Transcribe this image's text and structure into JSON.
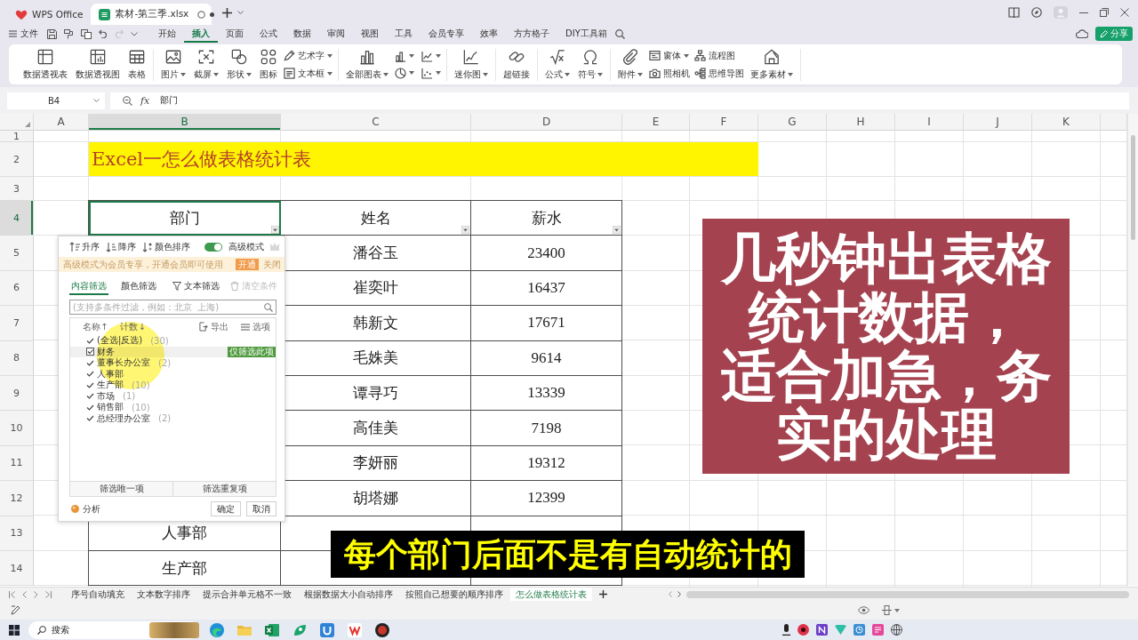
{
  "titlebar": {
    "tabs": [
      {
        "kind": "home",
        "label": "WPS Office",
        "selected": false,
        "unsaved": false
      },
      {
        "kind": "document",
        "label": "素材-第三季.xlsx",
        "selected": true,
        "unsaved": true
      }
    ]
  },
  "menubar": {
    "file": "文件",
    "undo": {
      "disabled": false
    },
    "redo": {
      "disabled": true
    },
    "tabs": [
      {
        "label": "开始",
        "selected": false
      },
      {
        "label": "插入",
        "selected": true
      },
      {
        "label": "页面",
        "selected": false
      },
      {
        "label": "公式",
        "selected": false
      },
      {
        "label": "数据",
        "selected": false
      },
      {
        "label": "审阅",
        "selected": false
      },
      {
        "label": "视图",
        "selected": false
      },
      {
        "label": "工具",
        "selected": false
      },
      {
        "label": "会员专享",
        "selected": false
      },
      {
        "label": "效率",
        "selected": false
      },
      {
        "label": "方方格子",
        "selected": false
      },
      {
        "label": "DIY工具箱",
        "selected": false
      }
    ],
    "share": "分享"
  },
  "ribbon": {
    "groups": [
      [
        {
          "kind": "large",
          "label": "数据透视表",
          "dropdown": false
        },
        {
          "kind": "large",
          "label": "数据透视图",
          "dropdown": false
        },
        {
          "kind": "large",
          "label": "表格",
          "dropdown": false
        }
      ],
      [
        {
          "kind": "large",
          "label": "图片",
          "dropdown": true
        },
        {
          "kind": "large",
          "label": "截屏",
          "dropdown": true
        },
        {
          "kind": "large",
          "label": "形状",
          "dropdown": true
        },
        {
          "kind": "large",
          "label": "图标",
          "dropdown": false
        },
        {
          "kind": "stack",
          "items": [
            {
              "label": "艺术字",
              "dropdown": true
            },
            {
              "label": "文本框",
              "dropdown": true
            }
          ]
        }
      ],
      [
        {
          "kind": "large",
          "label": "全部图表",
          "dropdown": true
        },
        {
          "kind": "grid",
          "items": [
            {
              "dropdown": true
            },
            {
              "dropdown": true
            },
            {
              "dropdown": true
            },
            {
              "dropdown": true
            }
          ]
        }
      ],
      [
        {
          "kind": "large",
          "label": "迷你图",
          "dropdown": true
        }
      ],
      [
        {
          "kind": "large",
          "label": "超链接",
          "dropdown": false
        }
      ],
      [
        {
          "kind": "large",
          "label": "公式",
          "dropdown": true
        },
        {
          "kind": "large",
          "label": "符号",
          "dropdown": true
        }
      ],
      [
        {
          "kind": "large",
          "label": "附件",
          "dropdown": true
        },
        {
          "kind": "stack",
          "items": [
            {
              "label": "窗体",
              "dropdown": true
            },
            {
              "label": "照相机",
              "dropdown": false
            }
          ]
        },
        {
          "kind": "stack",
          "items": [
            {
              "label": "流程图",
              "dropdown": false
            },
            {
              "label": "思维导图",
              "dropdown": false
            }
          ]
        },
        {
          "kind": "large",
          "label": "更多素材",
          "dropdown": true
        }
      ]
    ]
  },
  "formula_bar": {
    "name_box": "B4",
    "function_button": "fx",
    "formula": "部门"
  },
  "sheet": {
    "columns": [
      {
        "label": "A",
        "selected": false
      },
      {
        "label": "B",
        "selected": true
      },
      {
        "label": "C",
        "selected": false
      },
      {
        "label": "D",
        "selected": false
      },
      {
        "label": "E",
        "selected": false
      },
      {
        "label": "F",
        "selected": false
      },
      {
        "label": "G",
        "selected": false
      },
      {
        "label": "H",
        "selected": false
      },
      {
        "label": "I",
        "selected": false
      },
      {
        "label": "J",
        "selected": false
      },
      {
        "label": "K",
        "selected": false
      }
    ],
    "rows": [
      {
        "label": "1",
        "selected": false
      },
      {
        "label": "2",
        "selected": false
      },
      {
        "label": "3",
        "selected": false
      },
      {
        "label": "4",
        "selected": true
      },
      {
        "label": "5",
        "selected": false
      },
      {
        "label": "6",
        "selected": false
      },
      {
        "label": "7",
        "selected": false
      },
      {
        "label": "8",
        "selected": false
      },
      {
        "label": "9",
        "selected": false
      },
      {
        "label": "10",
        "selected": false
      },
      {
        "label": "11",
        "selected": false
      },
      {
        "label": "12",
        "selected": false
      },
      {
        "label": "13",
        "selected": false
      },
      {
        "label": "14",
        "selected": false
      }
    ],
    "title": "Excel一怎么做表格统计表",
    "table": {
      "headers": [
        {
          "label": "部门",
          "selected": true,
          "filter": true
        },
        {
          "label": "姓名",
          "selected": false,
          "filter": true
        },
        {
          "label": "薪水",
          "selected": false,
          "filter": true
        }
      ],
      "rows": [
        {
          "name": "潘谷玉",
          "salary": "23400"
        },
        {
          "name": "崔奕叶",
          "salary": "16437"
        },
        {
          "name": "韩新文",
          "salary": "17671"
        },
        {
          "name": "毛姝美",
          "salary": "9614"
        },
        {
          "name": "谭寻巧",
          "salary": "13339"
        },
        {
          "name": "高佳美",
          "salary": "7198"
        },
        {
          "name": "李妍丽",
          "salary": "19312"
        },
        {
          "name": "胡塔娜",
          "salary": "12399"
        },
        {
          "department": "人事部"
        },
        {
          "department": "生产部"
        }
      ]
    }
  },
  "filter_panel": {
    "sort_buttons": [
      {
        "label": "升序"
      },
      {
        "label": "降序"
      },
      {
        "label": "颜色排序"
      }
    ],
    "mode_toggle": {
      "label": "高级模式",
      "on": true
    },
    "banner": {
      "text": "高级模式为会员专享，开通会员即可使用",
      "button": "开通",
      "close": "关闭"
    },
    "tabs": [
      {
        "label": "内容筛选",
        "selected": true
      },
      {
        "label": "颜色筛选",
        "selected": false
      }
    ],
    "actions": [
      {
        "label": "文本筛选",
        "disabled": false
      },
      {
        "label": "清空条件",
        "disabled": true
      }
    ],
    "search": {
      "placeholder": "(支持多条件过滤，例如：北京  上海)"
    },
    "list_header": {
      "sort_name": "名称↑",
      "sort_count": "计数↓",
      "export": "导出",
      "options": "选项"
    },
    "items": [
      {
        "label": "(全选|反选)",
        "count": "(30)",
        "checked": true,
        "hovered": false
      },
      {
        "label": "财务",
        "checked": true,
        "hovered": true
      },
      {
        "label": "董事长办公室",
        "count": "(2)",
        "checked": true,
        "hovered": false
      },
      {
        "label": "人事部",
        "checked": true,
        "hovered": false
      },
      {
        "label": "生产部",
        "count": "(10)",
        "checked": true,
        "hovered": false
      },
      {
        "label": "市场",
        "count": "(1)",
        "checked": true,
        "hovered": false
      },
      {
        "label": "销售部",
        "count": "(10)",
        "checked": true,
        "hovered": false
      },
      {
        "label": "总经理办公室",
        "count": "(2)",
        "checked": true,
        "hovered": false
      }
    ],
    "only_button": "仅筛选此项",
    "bottom_buttons": [
      "筛选唯一项",
      "筛选重复项"
    ],
    "analyze": "分析",
    "ok": "确定",
    "cancel": "取消"
  },
  "note": {
    "paragraphs": [
      "几秒钟出表格统计数据，",
      "适合加急，务实的处理"
    ]
  },
  "caption": {
    "text": "每个部门后面不是有自动统计的"
  },
  "sheet_tabs": [
    {
      "label": "序号自动填充",
      "selected": false
    },
    {
      "label": "文本数字排序",
      "selected": false
    },
    {
      "label": "提示合并单元格不一致",
      "selected": false
    },
    {
      "label": "根据数据大小自动排序",
      "selected": false
    },
    {
      "label": "按照自己想要的顺序排序",
      "selected": false
    },
    {
      "label": "怎么做表格统计表",
      "selected": true
    }
  ],
  "taskbar": {
    "search": {
      "placeholder": "搜索"
    }
  }
}
